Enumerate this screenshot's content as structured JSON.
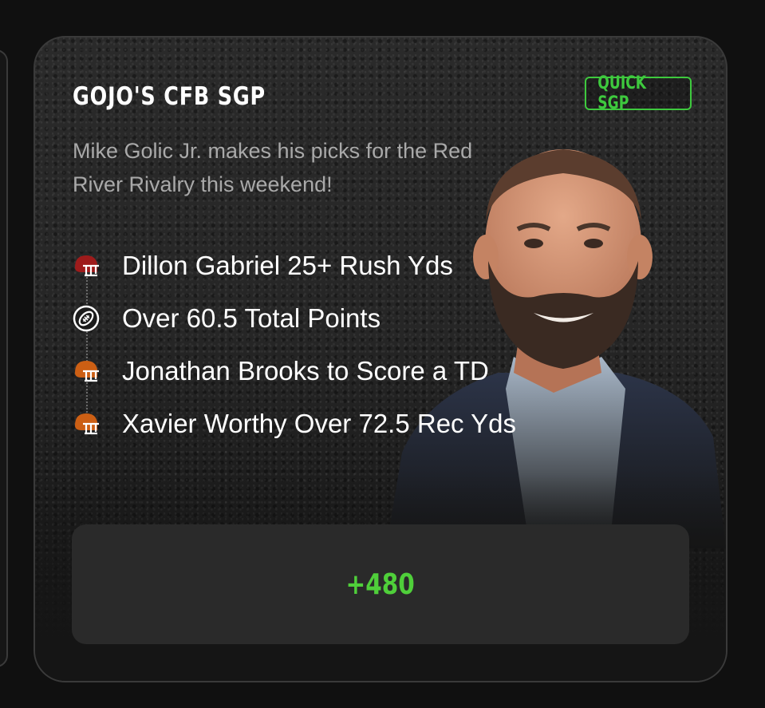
{
  "card": {
    "title": "GOJO'S CFB SGP",
    "badge": "QUICK SGP",
    "subtitle": "Mike Golic Jr. makes his picks for the Red River Rivalry this weekend!",
    "legs": [
      {
        "text": "Dillon Gabriel 25+ Rush Yds",
        "icon": "helmet-icon",
        "color": "#9e1b1b"
      },
      {
        "text": "Over 60.5 Total Points",
        "icon": "football-icon",
        "color": "#ffffff"
      },
      {
        "text": "Jonathan Brooks to Score a TD",
        "icon": "helmet-icon",
        "color": "#cc5f14"
      },
      {
        "text": "Xavier Worthy Over 72.5 Rec Yds",
        "icon": "helmet-icon",
        "color": "#cc5f14"
      }
    ],
    "odds": "+480"
  },
  "colors": {
    "accent_green": "#3ec93e",
    "odds_green": "#4fcf3a",
    "background": "#101010",
    "card_border": "#3a3a3a"
  }
}
